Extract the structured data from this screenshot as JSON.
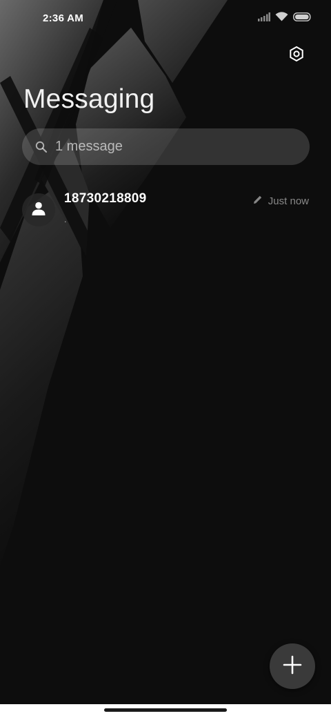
{
  "status_bar": {
    "time": "2:36 AM",
    "icons": [
      "signal-icon",
      "wifi-icon",
      "battery-icon"
    ]
  },
  "header": {
    "title": "Messaging",
    "settings_icon": "settings-icon"
  },
  "search": {
    "icon": "search-icon",
    "text": "1 message"
  },
  "conversations": [
    {
      "avatar_icon": "person-icon",
      "name": "18730218809",
      "snippet": ".",
      "draft_icon": "pencil-icon",
      "time": "Just now"
    }
  ],
  "fab": {
    "icon": "plus-icon"
  },
  "colors": {
    "background": "#0d0d0d",
    "search_bg": "#3a3a3a",
    "fab_bg": "#3a3a3a",
    "text_primary": "#ffffff"
  }
}
